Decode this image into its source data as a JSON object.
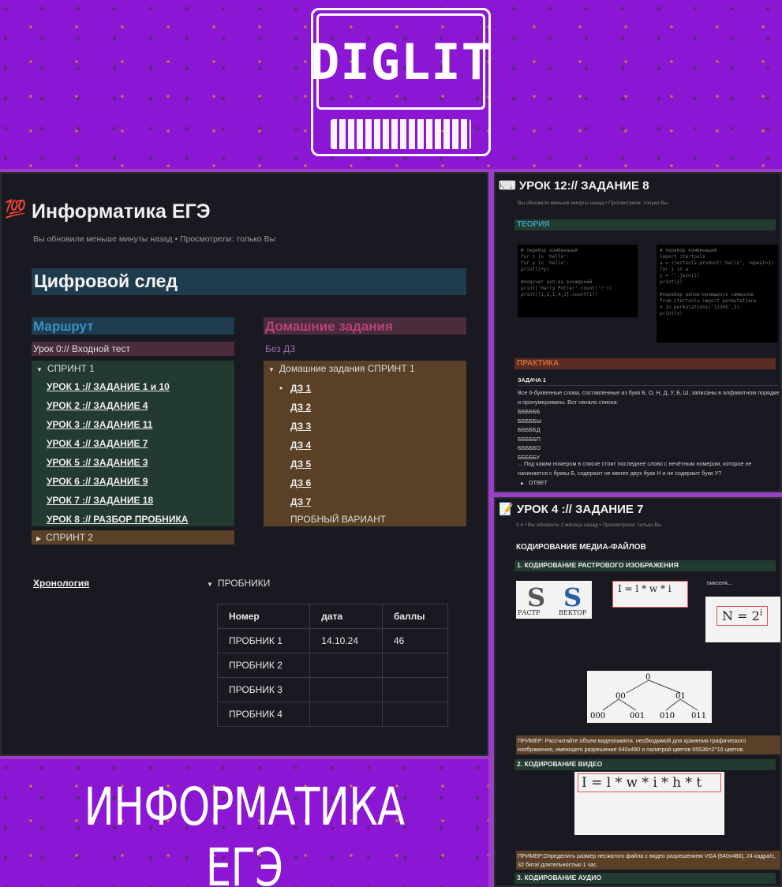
{
  "banner": {
    "logo": "DIGLIT"
  },
  "main": {
    "title": "Информатика ЕГЭ",
    "meta": "Вы обновили меньше минуты назад  • Просмотрели: только Вы",
    "heading": "Цифровой след",
    "route": {
      "header": "Маршрут",
      "entry_test": "Урок 0:// Входной тест",
      "sprint1_label": "СПРИНТ 1",
      "lessons": [
        "УРОК 1 :// ЗАДАНИЕ 1 и 10",
        "УРОК 2 :// ЗАДАНИЕ 4",
        "УРОК 3 :// ЗАДАНИЕ 11",
        "УРОК 4 :// ЗАДАНИЕ 7",
        "УРОК 5 :// ЗАДАНИЕ 3",
        "УРОК 6 :// ЗАДАНИЕ 9",
        "УРОК 7 :// ЗАДАНИЕ 18",
        "УРОК 8 :// РАЗБОР ПРОБНИКА"
      ],
      "sprint2_label": "СПРИНТ 2"
    },
    "homework": {
      "header": "Домашние задания",
      "no_hw": "Без ДЗ",
      "sprint1_label": "Домашние задания СПРИНТ 1",
      "items": [
        "ДЗ 1",
        "ДЗ 2",
        "ДЗ 3",
        "ДЗ 4",
        "ДЗ 5",
        "ДЗ 6 ",
        "ДЗ 7"
      ],
      "trial": "ПРОБНЫЙ ВАРИАНТ"
    },
    "chronology": "Хронология",
    "probniki": {
      "toggle": "ПРОБНИКИ",
      "columns": [
        "Номер",
        "дата",
        "баллы"
      ],
      "rows": [
        [
          "ПРОБНИК 1",
          "14.10.24",
          "46"
        ],
        [
          "ПРОБНИК 2",
          "",
          ""
        ],
        [
          "ПРОБНИК 3",
          "",
          ""
        ],
        [
          "ПРОБНИК 4",
          "",
          ""
        ]
      ]
    }
  },
  "footer": {
    "title": "ИНФОРМАТИКА ЕГЭ"
  },
  "panel12": {
    "title": "УРОК 12:// ЗАДАНИЕ 8",
    "meta": "Вы обновили меньше минуты назад  • Просмотрели: только Вы",
    "theory": "ТЕОРИЯ",
    "practice": "ПРАКТИКА",
    "task": "ЗАДАЧА 1",
    "task_text": "Все 6-буквенные слова, составленные из букв Б, О, Н, Д, У, Б, Ш, записаны в алфавитном порядке и пронумерованы. Вот начало списка:",
    "list": [
      "ББББББ",
      "БББББЫ",
      "БББББД",
      "БББББП",
      "БББББО",
      "БББББУ"
    ],
    "question": "... Под каким номером в списке стоит последнее слово с нечётным номером, которое не начинается с буквы Б, содержит не менее двух букв Н и не содержит букв У?",
    "answer_toggle": "ОТВЕТ"
  },
  "panel4": {
    "title": "УРОК 4 :// ЗАДАНИЕ 7",
    "meta": "2  4  • Вы обновили 2 месяца назад  • Просмотрели: только Вы",
    "heading": "КОДИРОВАНИЕ МЕДИА-ФАЙЛОВ",
    "sec1": "1. КОДИРОВАНИЕ РАСТРОВОГО ИЗОБРАЖЕНИЯ",
    "raster": "РАСТР",
    "vector": "ВЕКТОР",
    "formula1": "I = l * w * i",
    "pixels": "пикселя...",
    "formula2": "N = 2",
    "exp": "i",
    "example1": "ПРИМЕР:  Рассчитайте объем видеопамяти, необходимой для хранения графического изображения, имеющего разрешение 640х480 и палитрой цветов 65536=2^16 цветов.",
    "sec2": "2. КОДИРОВАНИЕ ВИДЕО",
    "formula3": "I = l * w * i * h * t",
    "example2": "ПРИМЕР:Определить размер несжатого файла с видео разрешением VGA (640х480), 24 кадра/с, 32 бита/ длительностью 1 час.",
    "sec3": "3. КОДИРОВАНИЕ АУДИО",
    "tree": [
      "0",
      "00",
      "01",
      "000",
      "001",
      "010",
      "011"
    ]
  },
  "colors": {
    "route_bg": "#1f3c4f",
    "sprint_bg": "#223a2f",
    "hw_bg": "#5a4026",
    "entry_bg": "#4a2c3c",
    "purple": "#8b16d4"
  }
}
